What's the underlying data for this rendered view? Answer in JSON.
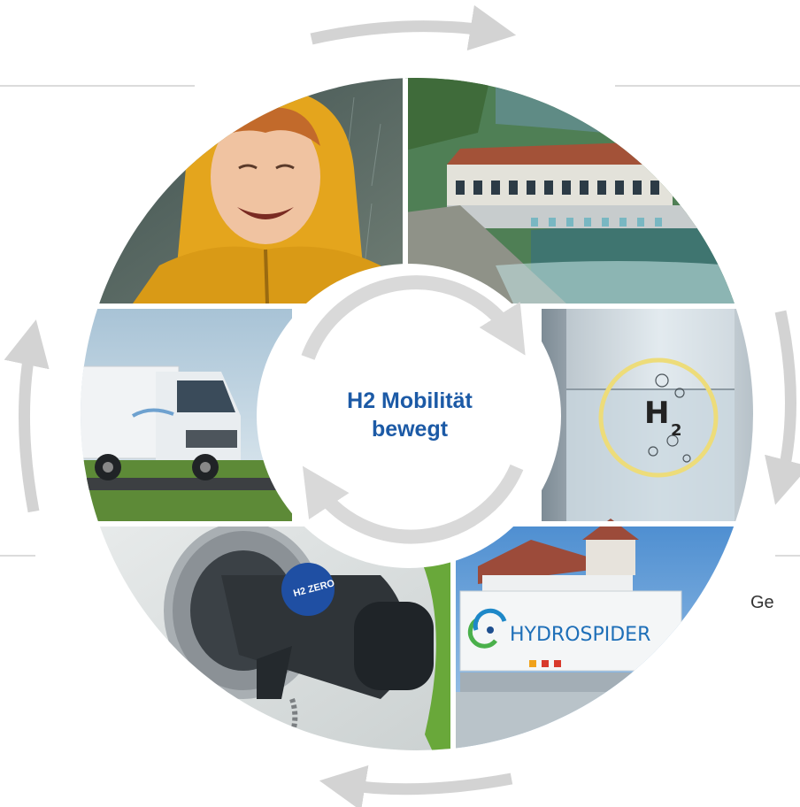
{
  "center": {
    "line1": "H2 Mobilität",
    "line2": "bewegt"
  },
  "segments": [
    {
      "id": "child",
      "subject": "child in yellow raincoat"
    },
    {
      "id": "hydropower",
      "subject": "hydropower station on river"
    },
    {
      "id": "h2",
      "subject": "glass of water with H2 symbol",
      "symbol": "H",
      "subscript": "2"
    },
    {
      "id": "container",
      "subject": "hydrogen transport container",
      "brand": "HYDROSPIDER"
    },
    {
      "id": "nozzle",
      "subject": "hydrogen fuel nozzle",
      "brand": "H2 ZERO"
    },
    {
      "id": "truck",
      "subject": "hydrogen fuel cell truck"
    }
  ],
  "side_text": {
    "right_cut": "Ge"
  },
  "colors": {
    "title_blue": "#1c5aa6",
    "arrow_gray": "#d3d3d3",
    "line_gray": "#cfcfcf",
    "ring_yellow": "#eddc7a"
  },
  "icons": [
    "cycle-arrow-icon",
    "hydrogen-symbol-icon",
    "hydrospider-logo-icon"
  ]
}
